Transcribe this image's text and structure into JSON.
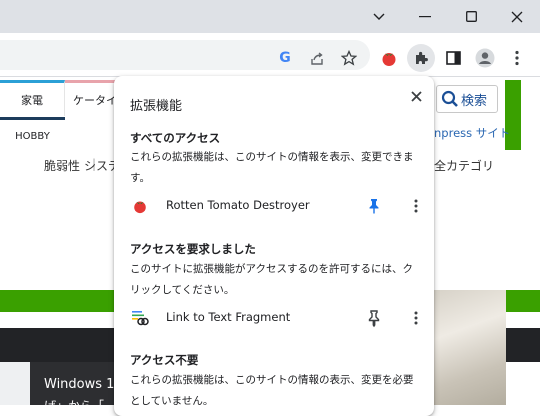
{
  "window": {
    "minimize_glyph": "—",
    "chevron_glyph": "⌄"
  },
  "toolbar": {
    "google_letter": "G",
    "icons": [
      "google-icon",
      "share-icon",
      "bookmark-star-icon",
      "tomato-extension-icon",
      "extensions-puzzle-icon",
      "side-panel-icon",
      "profile-icon",
      "menu-icon"
    ]
  },
  "page": {
    "nav_tabs": [
      "家電",
      "ケータイ",
      "HOBBY"
    ],
    "search_label": "検索",
    "impress_link": "npress サイト",
    "subnav": [
      "脆弱性",
      "システ"
    ],
    "all_categories": "全カテゴリ",
    "article_line1": "Windows 1",
    "article_line2": "げ」から「",
    "accent_green": "#3aa000"
  },
  "popup": {
    "title": "拡張機能",
    "close_glyph": "✕",
    "sections": [
      {
        "heading": "すべてのアクセス",
        "description": "これらの拡張機能は、このサイトの情報を表示、変更できます。",
        "extension": {
          "name": "Rotten Tomato Destroyer",
          "pinned": true,
          "icon": "tomato-icon"
        }
      },
      {
        "heading": "アクセスを要求しました",
        "description": "このサイトに拡張機能がアクセスするのを許可するには、クリックしてください。",
        "extension": {
          "name": "Link to Text Fragment",
          "pinned": false,
          "icon": "link-fragment-icon"
        }
      },
      {
        "heading": "アクセス不要",
        "description": "これらの拡張機能は、このサイトの情報の表示、変更を必要としていません。"
      }
    ],
    "pin_color": "#1a73e8"
  }
}
